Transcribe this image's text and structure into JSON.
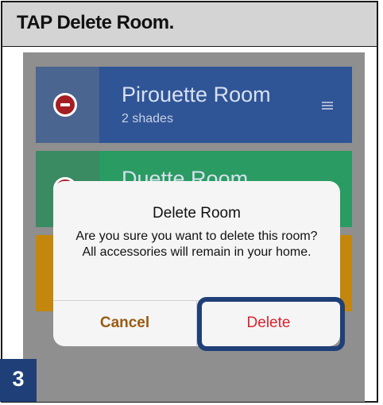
{
  "instruction": "TAP Delete Room.",
  "step_number": "3",
  "rooms": [
    {
      "name": "Pirouette Room",
      "subtitle": "2 shades",
      "color": "#2f5597",
      "strip_color": "#4a6590"
    },
    {
      "name": "Duette Room",
      "subtitle": "",
      "color": "#2a9b62",
      "strip_color": "#3a8a62"
    },
    {
      "name": "",
      "subtitle": "",
      "color": "#c4860c",
      "strip_color": "#c4860c"
    }
  ],
  "dialog": {
    "title": "Delete Room",
    "message": "Are you sure you want to delete this room? All accessories will remain in your home.",
    "cancel_label": "Cancel",
    "delete_label": "Delete"
  },
  "colors": {
    "highlight": "#1f3f78",
    "cancel_text": "#9a5a12",
    "delete_text": "#d9232e",
    "overlay_background": "#8f8f8f"
  },
  "icons": {
    "remove": "minus-circle-icon",
    "reorder": "hamburger-icon"
  }
}
